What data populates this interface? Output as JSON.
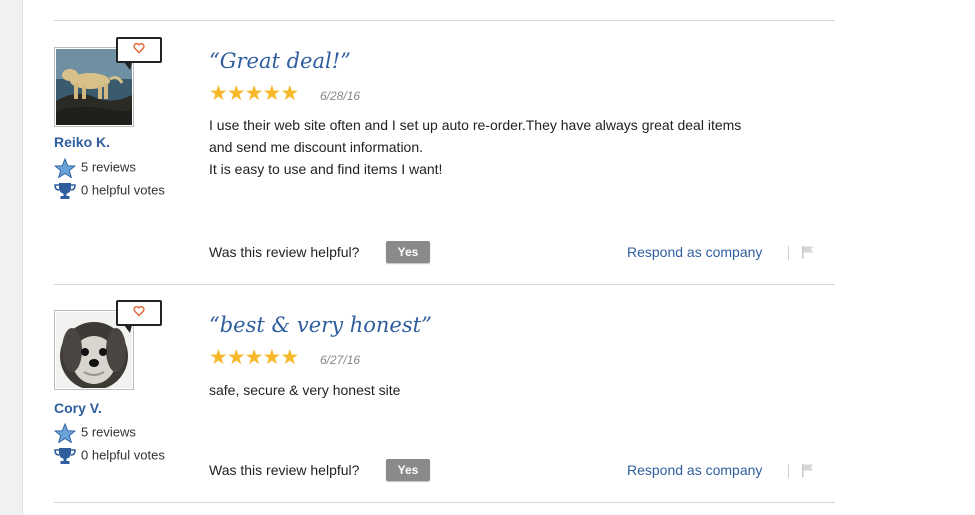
{
  "reviews": [
    {
      "reviewer_name": "Reiko K.",
      "review_count": "5 reviews",
      "helpful_votes": "0 helpful votes",
      "title": "“Great deal!”",
      "rating": 5,
      "date": "6/28/16",
      "body": [
        "I use their web site often and I set up auto re-order.They have always great deal items",
        "and send me discount information.",
        "It is easy to use and find items I want!"
      ],
      "helpful_prompt": "Was this review helpful?",
      "yes_label": "Yes",
      "respond_label": "Respond as company",
      "avatar": "dog-on-rocks-photo"
    },
    {
      "reviewer_name": "Cory V.",
      "review_count": "5 reviews",
      "helpful_votes": "0 helpful votes",
      "title": "“best & very honest”",
      "rating": 5,
      "date": "6/27/16",
      "body": [
        "safe, secure & very honest site"
      ],
      "helpful_prompt": "Was this review helpful?",
      "yes_label": "Yes",
      "respond_label": "Respond as company",
      "avatar": "shih-tzu-dog-photo"
    }
  ],
  "colors": {
    "link": "#2f5e9e",
    "star": "#f6b729",
    "heart": "#e06a3b",
    "yes_button": "#8a8a8a"
  }
}
